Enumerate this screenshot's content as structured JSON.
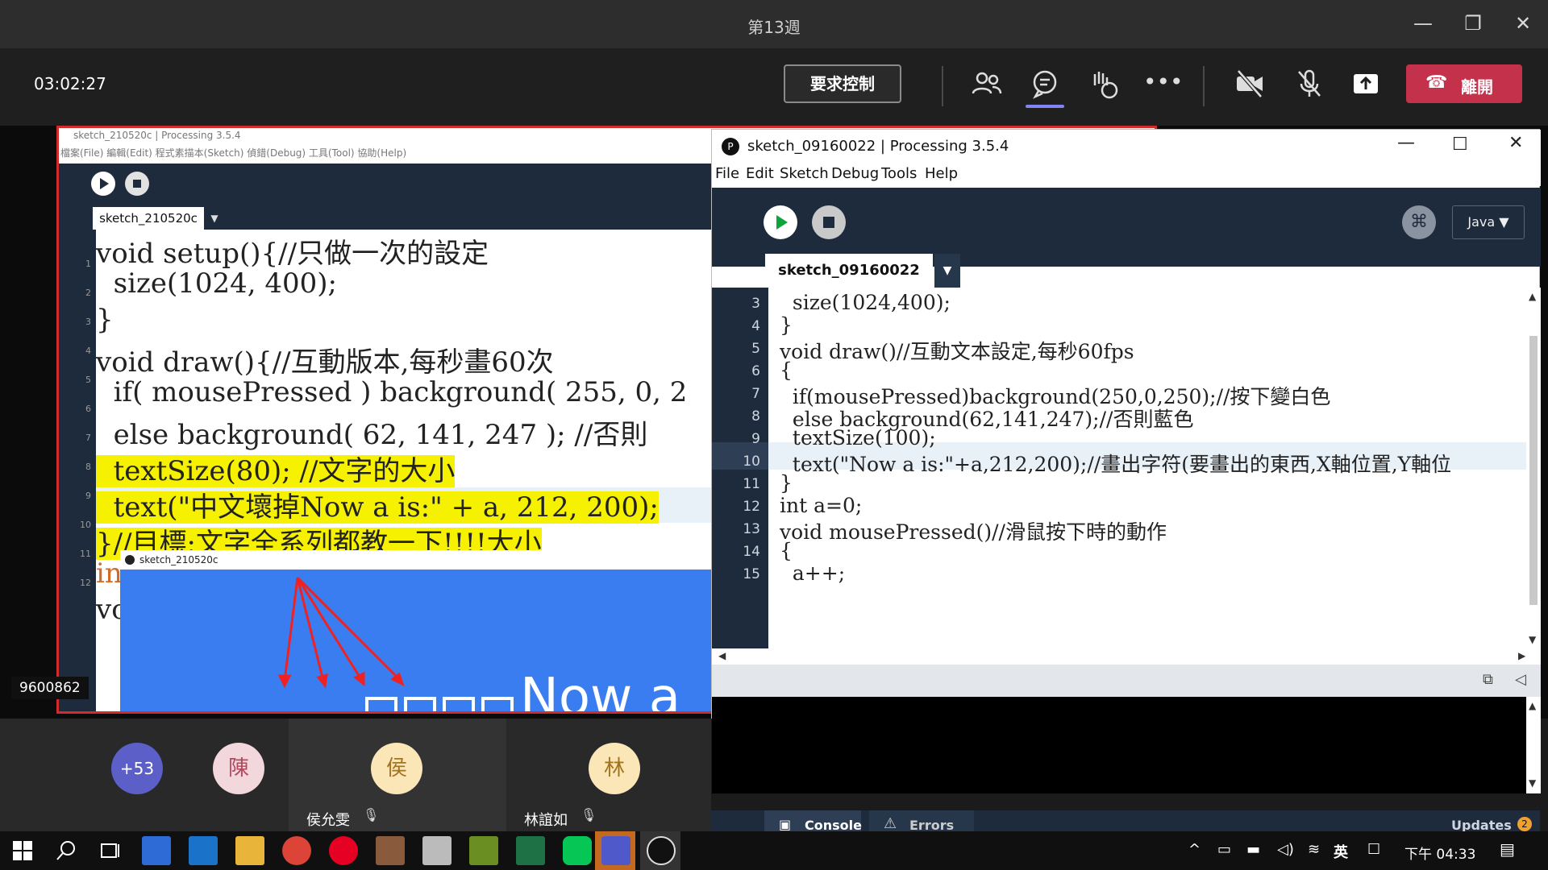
{
  "window": {
    "title": "第13週"
  },
  "meeting": {
    "timer": "03:02:27",
    "request_control": "要求控制",
    "leave": "離開",
    "participant_count": "+53",
    "participants": [
      {
        "avatar": "陳",
        "name": ""
      },
      {
        "avatar": "侯",
        "name": "侯允雯"
      },
      {
        "avatar": "林",
        "name": "林誼如"
      }
    ],
    "presenter_id": "9600862"
  },
  "shared": {
    "title": "sketch_210520c | Processing 3.5.4",
    "menu": "檔案(File)  編輯(Edit)  程式素描本(Sketch)  偵錯(Debug)  工具(Tool)  協助(Help)",
    "tab": "sketch_210520c",
    "lines": [
      {
        "n": "1",
        "code": "void setup(){//只做一次的設定"
      },
      {
        "n": "2",
        "code": "  size(1024, 400);"
      },
      {
        "n": "3",
        "code": "}"
      },
      {
        "n": "4",
        "code": "void draw(){//互動版本,每秒畫60次"
      },
      {
        "n": "5",
        "code": "  if( mousePressed ) background( 255, 0, 2"
      },
      {
        "n": "6",
        "code": "  else background( 62, 141, 247 ); //否則"
      },
      {
        "n": "7",
        "code": "  textSize(80); //文字的大小"
      },
      {
        "n": "8",
        "code": "  text(\"中文壞掉Now a is:\" + a, 212, 200);"
      },
      {
        "n": "9",
        "code": "}//目標:文字全系列都教一下!!!!大小"
      },
      {
        "n": "10",
        "code": "in"
      },
      {
        "n": "11",
        "code": "vo"
      },
      {
        "n": "12",
        "code": ""
      }
    ],
    "sketch_window_title": "sketch_210520c",
    "sketch_text": "Now a"
  },
  "ide": {
    "title": "sketch_09160022 | Processing 3.5.4",
    "menu": [
      "File",
      "Edit",
      "Sketch",
      "Debug",
      "Tools",
      "Help"
    ],
    "mode": "Java ▼",
    "tab": "sketch_09160022",
    "lines": [
      {
        "n": "3",
        "code": "  size(1024,400);"
      },
      {
        "n": "4",
        "code": "}"
      },
      {
        "n": "5",
        "code": "void draw()//互動文本設定,每秒60fps"
      },
      {
        "n": "6",
        "code": "{"
      },
      {
        "n": "7",
        "code": "  if(mousePressed)background(250,0,250);//按下變白色"
      },
      {
        "n": "8",
        "code": "  else background(62,141,247);//否則藍色"
      },
      {
        "n": "9",
        "code": "  textSize(100);"
      },
      {
        "n": "10",
        "code": "  text(\"Now a is:\"+a,212,200);//畫出字符(要畫出的東西,X軸位置,Y軸位"
      },
      {
        "n": "11",
        "code": "}"
      },
      {
        "n": "12",
        "code": "int a=0;"
      },
      {
        "n": "13",
        "code": "void mousePressed()//滑鼠按下時的動作"
      },
      {
        "n": "14",
        "code": "{"
      },
      {
        "n": "15",
        "code": "  a++;"
      }
    ],
    "console_tab": "Console",
    "errors_tab": "Errors",
    "updates": "Updates",
    "updates_count": "2"
  },
  "taskbar": {
    "ime": "英",
    "clock": "下午 04:33"
  }
}
